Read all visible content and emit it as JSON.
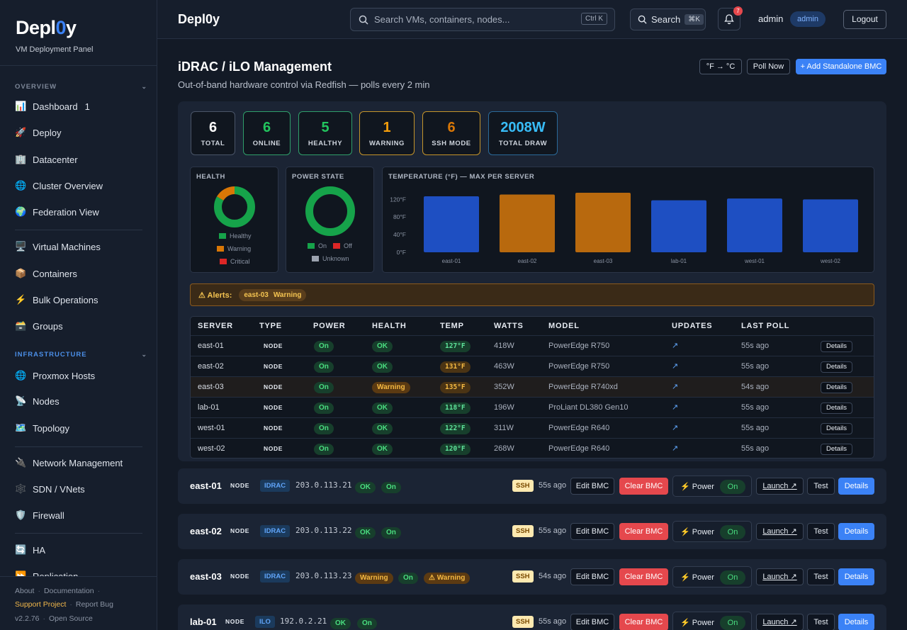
{
  "brand": {
    "name_pre": "Depl",
    "name_zero": "0",
    "name_post": "y",
    "subtitle": "VM Deployment Panel"
  },
  "sidebar": {
    "overview_label": "OVERVIEW",
    "infra_label": "INFRASTRUCTURE",
    "items": [
      {
        "label": "Dashboard",
        "icon": "📊",
        "count": "1"
      },
      {
        "label": "Deploy",
        "icon": "🚀"
      },
      {
        "label": "Datacenter",
        "icon": "🏢"
      },
      {
        "label": "Cluster Overview",
        "icon": "🌐"
      },
      {
        "label": "Federation View",
        "icon": "🌍"
      },
      {
        "label": "Virtual Machines",
        "icon": "🖥️"
      },
      {
        "label": "Containers",
        "icon": "📦"
      },
      {
        "label": "Bulk Operations",
        "icon": "⚡"
      },
      {
        "label": "Groups",
        "icon": "🗃️"
      },
      {
        "label": "Proxmox Hosts",
        "icon": "🌐"
      },
      {
        "label": "Nodes",
        "icon": "📡"
      },
      {
        "label": "Topology",
        "icon": "🗺️"
      },
      {
        "label": "Network Management",
        "icon": "🔌"
      },
      {
        "label": "SDN / VNets",
        "icon": "🕸️"
      },
      {
        "label": "Firewall",
        "icon": "🛡️"
      },
      {
        "label": "HA",
        "icon": "🔄"
      },
      {
        "label": "Replication",
        "icon": "⏩"
      }
    ],
    "footer": {
      "about": "About",
      "docs": "Documentation",
      "support": "Support Project",
      "bug": "Report Bug",
      "version": "v2.2.76",
      "license": "Open Source"
    }
  },
  "topbar": {
    "title": "Depl0y",
    "search_placeholder": "Search VMs, containers, nodes...",
    "search_kbd": "Ctrl K",
    "search_btn": "Search",
    "search_btn_kbd": "⌘K",
    "notif_count": "7",
    "user": "admin",
    "role": "admin",
    "logout": "Logout"
  },
  "page": {
    "title": "iDRAC / iLO Management",
    "subtitle": "Out-of-band hardware control via Redfish — polls every 2 min",
    "unit_toggle": "°F → °C",
    "poll_now": "Poll Now",
    "add_bmc": "+ Add Standalone BMC"
  },
  "stats": [
    {
      "value": "6",
      "label": "TOTAL",
      "color": "#ffffff",
      "border": "#4a5568"
    },
    {
      "value": "6",
      "label": "ONLINE",
      "color": "#22c55e",
      "border": "#2f9e6a"
    },
    {
      "value": "5",
      "label": "HEALTHY",
      "color": "#22c55e",
      "border": "#2f9e6a"
    },
    {
      "value": "1",
      "label": "WARNING",
      "color": "#f59e0b",
      "border": "#c4942a"
    },
    {
      "value": "6",
      "label": "SSH MODE",
      "color": "#d97706",
      "border": "#c4942a"
    },
    {
      "value": "2008W",
      "label": "TOTAL DRAW",
      "color": "#38bdf8",
      "border": "#2b6a99"
    }
  ],
  "health_card": {
    "title": "HEALTH",
    "legend": [
      "Healthy",
      "Warning",
      "Critical"
    ],
    "colors": [
      "#16a34a",
      "#d97706",
      "#dc2626"
    ],
    "values": [
      5,
      1,
      0
    ]
  },
  "power_card": {
    "title": "POWER STATE",
    "legend": [
      "On",
      "Off",
      "Unknown"
    ],
    "colors": [
      "#16a34a",
      "#dc2626",
      "#9ca3af"
    ],
    "values": [
      6,
      0,
      0
    ]
  },
  "chart_data": {
    "type": "bar",
    "title": "TEMPERATURE (°F) — MAX PER SERVER",
    "categories": [
      "east-01",
      "east-02",
      "east-03",
      "lab-01",
      "west-01",
      "west-02"
    ],
    "values": [
      127,
      131,
      135,
      118,
      122,
      120
    ],
    "colors": [
      "#1e4fc2",
      "#b8690e",
      "#b8690e",
      "#1e4fc2",
      "#1e4fc2",
      "#1e4fc2"
    ],
    "yticks": [
      "120°F",
      "80°F",
      "40°F",
      "0°F"
    ],
    "ylim": [
      0,
      135
    ]
  },
  "alerts": {
    "label": "⚠ Alerts:",
    "server": "east-03",
    "status": "Warning"
  },
  "table": {
    "headers": [
      "SERVER",
      "TYPE",
      "POWER",
      "HEALTH",
      "TEMP",
      "WATTS",
      "MODEL",
      "UPDATES",
      "LAST POLL"
    ],
    "rows": [
      {
        "server": "east-01",
        "type": "NODE",
        "power": "On",
        "health": "OK",
        "temp": "127°F",
        "watts": "418W",
        "model": "PowerEdge R750",
        "updates": "↗",
        "poll": "55s ago",
        "details": "Details"
      },
      {
        "server": "east-02",
        "type": "NODE",
        "power": "On",
        "health": "OK",
        "temp": "131°F",
        "watts": "463W",
        "model": "PowerEdge R750",
        "updates": "↗",
        "poll": "55s ago",
        "details": "Details"
      },
      {
        "server": "east-03",
        "type": "NODE",
        "power": "On",
        "health": "Warning",
        "temp": "135°F",
        "watts": "352W",
        "model": "PowerEdge R740xd",
        "updates": "↗",
        "poll": "54s ago",
        "details": "Details"
      },
      {
        "server": "lab-01",
        "type": "NODE",
        "power": "On",
        "health": "OK",
        "temp": "118°F",
        "watts": "196W",
        "model": "ProLiant DL380 Gen10",
        "updates": "↗",
        "poll": "55s ago",
        "details": "Details"
      },
      {
        "server": "west-01",
        "type": "NODE",
        "power": "On",
        "health": "OK",
        "temp": "122°F",
        "watts": "311W",
        "model": "PowerEdge R640",
        "updates": "↗",
        "poll": "55s ago",
        "details": "Details"
      },
      {
        "server": "west-02",
        "type": "NODE",
        "power": "On",
        "health": "OK",
        "temp": "120°F",
        "watts": "268W",
        "model": "PowerEdge R640",
        "updates": "↗",
        "poll": "55s ago",
        "details": "Details"
      }
    ]
  },
  "cards": [
    {
      "name": "east-01",
      "type": "NODE",
      "bmc": "IDRAC",
      "ip": "203.0.113.21",
      "health": "OK",
      "power": "On",
      "ssh": "SSH",
      "ago": "55s ago",
      "edit": "Edit BMC",
      "clear": "Clear BMC",
      "power_label": "⚡ Power",
      "power_state": "On",
      "launch": "Launch ↗",
      "test": "Test",
      "details": "Details"
    },
    {
      "name": "east-02",
      "type": "NODE",
      "bmc": "IDRAC",
      "ip": "203.0.113.22",
      "health": "OK",
      "power": "On",
      "ssh": "SSH",
      "ago": "55s ago",
      "edit": "Edit BMC",
      "clear": "Clear BMC",
      "power_label": "⚡ Power",
      "power_state": "On",
      "launch": "Launch ↗",
      "test": "Test",
      "details": "Details"
    },
    {
      "name": "east-03",
      "type": "NODE",
      "bmc": "IDRAC",
      "ip": "203.0.113.23",
      "health": "Warning",
      "power": "On",
      "warn": "⚠ Warning",
      "ssh": "SSH",
      "ago": "54s ago",
      "edit": "Edit BMC",
      "clear": "Clear BMC",
      "power_label": "⚡ Power",
      "power_state": "On",
      "launch": "Launch ↗",
      "test": "Test",
      "details": "Details"
    },
    {
      "name": "lab-01",
      "type": "NODE",
      "bmc": "ILO",
      "ip": "192.0.2.21",
      "health": "OK",
      "power": "On",
      "ssh": "SSH",
      "ago": "55s ago",
      "edit": "Edit BMC",
      "clear": "Clear BMC",
      "power_label": "⚡ Power",
      "power_state": "On",
      "launch": "Launch ↗",
      "test": "Test",
      "details": "Details"
    }
  ]
}
